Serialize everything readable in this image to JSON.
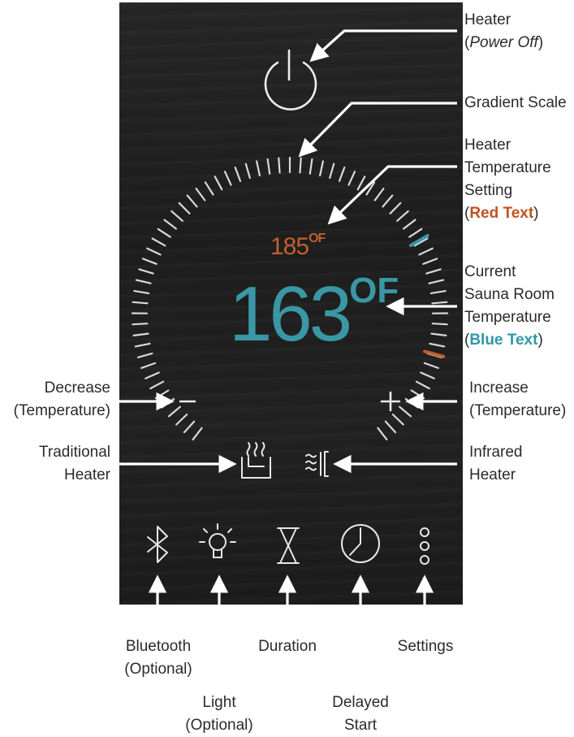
{
  "controller": {
    "setpoint_value": "185",
    "setpoint_unit": "OF",
    "current_value": "163",
    "current_unit": "OF",
    "minus_symbol": "−",
    "plus_symbol": "+"
  },
  "labels": {
    "heater_line1": "Heater",
    "heater_line2_open": "(",
    "heater_line2_text": "Power Off",
    "heater_line2_close": ")",
    "gradient_scale": "Gradient Scale",
    "setting_line1": "Heater",
    "setting_line2": "Temperature",
    "setting_line3": "Setting",
    "setting_line4_open": "(",
    "setting_line4_text": "Red Text",
    "setting_line4_close": ")",
    "current_line1": "Current",
    "current_line2": "Sauna Room",
    "current_line3": "Temperature",
    "current_line4_open": "(",
    "current_line4_text": "Blue Text",
    "current_line4_close": ")",
    "decrease_line1": "Decrease",
    "decrease_line2": "(Temperature)",
    "increase_line1": "Increase",
    "increase_line2": "(Temperature)",
    "traditional_line1": "Traditional",
    "traditional_line2": "Heater",
    "infrared_line1": "Infrared",
    "infrared_line2": "Heater",
    "bluetooth_line1": "Bluetooth",
    "bluetooth_line2": "(Optional)",
    "light_line1": "Light",
    "light_line2": "(Optional)",
    "duration": "Duration",
    "delayed_line1": "Delayed",
    "delayed_line2": "Start",
    "settings": "Settings"
  },
  "colors": {
    "setpoint": "#c2602c",
    "current": "#3a97a5",
    "red_text": "#c0521f",
    "blue_text": "#2f98a8",
    "icons": "#e6e6e6"
  }
}
